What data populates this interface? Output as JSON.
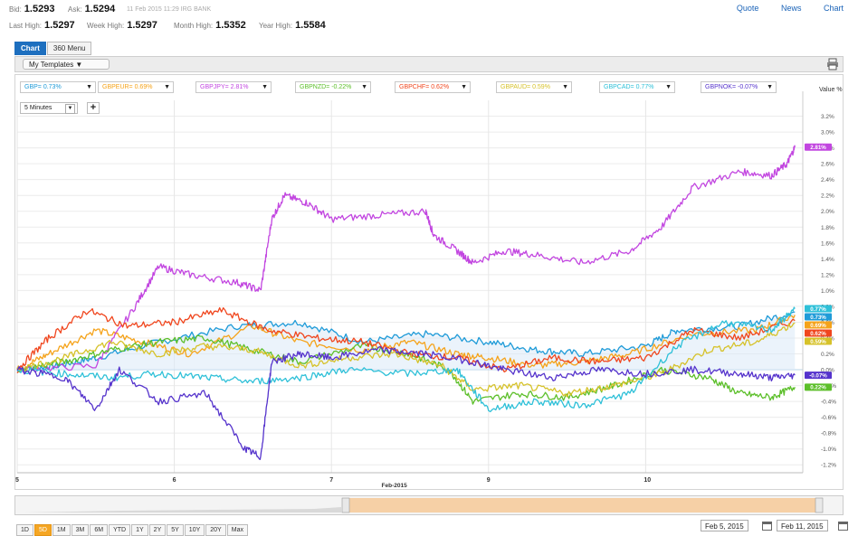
{
  "quote": {
    "items": [
      {
        "label": "Bid:",
        "value": "1.5293"
      },
      {
        "label": "Ask:",
        "value": "1.5294"
      },
      {
        "label": "Last High:",
        "value": "1.5297"
      },
      {
        "label": "Week High:",
        "value": "1.5297"
      },
      {
        "label": "Month High:",
        "value": "1.5352"
      },
      {
        "label": "Year High:",
        "value": "1.5584"
      }
    ],
    "timestamp": "11 Feb 2015 11:29 IRG BANK"
  },
  "links": {
    "quote": "Quote",
    "news": "News",
    "chart": "Chart"
  },
  "tabs": [
    {
      "label": "Chart"
    },
    {
      "label": "360 Menu"
    }
  ],
  "toolbar": {
    "templates_label": "My Templates ▼"
  },
  "controls": {
    "interval": "5 Minutes",
    "dropdown": "▼",
    "plus": "+"
  },
  "bottom": {
    "ranges": [
      "1D",
      "5D",
      "1M",
      "3M",
      "6M",
      "YTD",
      "1Y",
      "2Y",
      "5Y",
      "10Y",
      "20Y",
      "Max"
    ],
    "active_range": "5D",
    "date_from": "Feb 5, 2015",
    "date_to": "Feb 11, 2015"
  },
  "chart_data": {
    "type": "line",
    "ylabel": "Value %",
    "xlabel": "Feb-2015",
    "ylim": [
      -1.3,
      3.4
    ],
    "xlim": [
      0,
      5
    ],
    "x_ticks": [
      {
        "x": 0,
        "label": "5"
      },
      {
        "x": 1,
        "label": "6"
      },
      {
        "x": 2,
        "label": "7"
      },
      {
        "x": 3,
        "label": "9"
      },
      {
        "x": 4,
        "label": "10"
      }
    ],
    "y_ticks": [
      3.2,
      3.0,
      2.8,
      2.6,
      2.4,
      2.2,
      2.0,
      1.8,
      1.6,
      1.4,
      1.2,
      1.0,
      0.8,
      0.6,
      0.4,
      0.2,
      0.0,
      -0.2,
      -0.4,
      -0.6,
      -0.8,
      -1.0,
      -1.2
    ],
    "y_tick_labels": [
      "3.2%",
      "3.0%",
      "2.8%",
      "2.6%",
      "2.4%",
      "2.2%",
      "2.0%",
      "1.8%",
      "1.6%",
      "1.4%",
      "1.2%",
      "1.0%",
      "0.8%",
      "0.6%",
      "0.4%",
      "0.2%",
      "0.0%",
      "-0.2%",
      "-0.4%",
      "-0.6%",
      "-0.8%",
      "-1.0%",
      "-1.2%"
    ],
    "grid": true,
    "series": [
      {
        "name": "GBP=",
        "legend": "GBP= 0.73%",
        "end_label": "0.73%",
        "color": "#1f9bd8",
        "x": [
          0,
          0.25,
          0.5,
          0.9,
          1.4,
          1.8,
          2.2,
          2.6,
          3.0,
          3.3,
          3.6,
          4.0,
          4.2,
          4.6,
          4.95
        ],
        "y": [
          0.0,
          0.05,
          0.15,
          0.35,
          0.55,
          0.6,
          0.35,
          0.45,
          0.35,
          0.25,
          0.2,
          0.3,
          0.5,
          0.55,
          0.73
        ]
      },
      {
        "name": "GBPEUR=",
        "legend": "GBPEUR= 0.69%",
        "end_label": "0.69%",
        "color": "#f5a31a",
        "x": [
          0,
          0.2,
          0.5,
          0.8,
          1.1,
          1.5,
          1.8,
          2.2,
          2.5,
          2.8,
          3.0,
          3.3,
          3.6,
          3.9,
          4.3,
          4.7,
          4.95
        ],
        "y": [
          0.0,
          0.2,
          0.5,
          0.35,
          0.2,
          0.55,
          0.35,
          0.25,
          0.35,
          0.2,
          0.15,
          0.05,
          0.1,
          0.2,
          0.45,
          0.5,
          0.69
        ]
      },
      {
        "name": "GBPJPY=",
        "legend": "GBPJPY= 2.81%",
        "end_label": "2.81%",
        "color": "#c246e0",
        "x": [
          0,
          0.5,
          0.75,
          0.9,
          1.1,
          1.4,
          1.55,
          1.62,
          1.7,
          1.85,
          2.0,
          2.3,
          2.6,
          2.65,
          2.8,
          2.9,
          3.1,
          3.3,
          3.6,
          3.9,
          4.1,
          4.3,
          4.6,
          4.8,
          4.9,
          4.95
        ],
        "y": [
          0.0,
          0.05,
          0.8,
          1.3,
          1.2,
          1.1,
          1.0,
          1.9,
          2.2,
          2.1,
          1.9,
          1.95,
          2.0,
          1.7,
          1.5,
          1.35,
          1.5,
          1.45,
          1.35,
          1.5,
          1.8,
          2.3,
          2.5,
          2.45,
          2.6,
          2.81
        ]
      },
      {
        "name": "GBPNZD=",
        "legend": "GBPNZD= -0.22%",
        "end_label": "0.22%",
        "color": "#5cbf2a",
        "x": [
          0,
          0.3,
          0.6,
          0.9,
          1.2,
          1.5,
          1.8,
          2.2,
          2.5,
          2.75,
          2.9,
          3.2,
          3.5,
          3.8,
          4.1,
          4.4,
          4.6,
          4.8,
          4.95
        ],
        "y": [
          0.0,
          0.1,
          0.25,
          0.35,
          0.4,
          0.25,
          0.1,
          0.3,
          0.2,
          0.0,
          -0.4,
          -0.3,
          -0.35,
          -0.2,
          0.0,
          -0.1,
          -0.3,
          -0.35,
          -0.22
        ]
      },
      {
        "name": "GBPCHF=",
        "legend": "GBPCHF= 0.62%",
        "end_label": "0.62%",
        "color": "#f0461e",
        "x": [
          0,
          0.2,
          0.45,
          0.7,
          1.0,
          1.3,
          1.6,
          1.9,
          2.2,
          2.5,
          2.8,
          3.1,
          3.4,
          3.7,
          4.0,
          4.3,
          4.6,
          4.95
        ],
        "y": [
          0.0,
          0.4,
          0.75,
          0.55,
          0.6,
          0.75,
          0.5,
          0.4,
          0.35,
          0.2,
          0.15,
          0.0,
          0.15,
          0.1,
          0.15,
          0.5,
          0.4,
          0.62
        ]
      },
      {
        "name": "GBPAUD=",
        "legend": "GBPAUD= 0.59%",
        "end_label": "0.59%",
        "color": "#d6c22a",
        "x": [
          0,
          0.3,
          0.6,
          0.9,
          1.2,
          1.5,
          1.8,
          2.1,
          2.4,
          2.7,
          2.9,
          3.2,
          3.5,
          3.8,
          4.1,
          4.4,
          4.7,
          4.95
        ],
        "y": [
          0.0,
          0.15,
          0.35,
          0.2,
          0.3,
          0.25,
          0.05,
          0.15,
          0.2,
          0.05,
          -0.25,
          -0.2,
          -0.3,
          -0.2,
          -0.05,
          0.25,
          0.35,
          0.59
        ]
      },
      {
        "name": "GBPCAD=",
        "legend": "GBPCAD= 0.77%",
        "end_label": "0.77%",
        "color": "#2ec0d8",
        "x": [
          0,
          0.3,
          0.6,
          0.9,
          1.2,
          1.5,
          1.8,
          2.1,
          2.5,
          2.8,
          3.0,
          3.3,
          3.6,
          3.9,
          4.2,
          4.5,
          4.8,
          4.95
        ],
        "y": [
          0.0,
          -0.05,
          -0.1,
          -0.05,
          -0.1,
          -0.15,
          -0.1,
          0.0,
          -0.05,
          0.0,
          -0.5,
          -0.4,
          -0.45,
          -0.3,
          0.3,
          0.6,
          0.5,
          0.77
        ]
      },
      {
        "name": "GBPNOK=",
        "legend": "GBPNOK= -0.07%",
        "end_label": "-0.07%",
        "color": "#5533cc",
        "x": [
          0,
          0.3,
          0.5,
          0.65,
          0.9,
          1.2,
          1.45,
          1.55,
          1.62,
          1.8,
          2.0,
          2.3,
          2.6,
          2.9,
          3.1,
          3.4,
          3.7,
          4.0,
          4.3,
          4.6,
          4.8,
          4.95
        ],
        "y": [
          0.0,
          -0.1,
          -0.5,
          0.0,
          -0.4,
          -0.3,
          -1.0,
          -1.1,
          0.1,
          0.2,
          0.15,
          0.25,
          0.2,
          0.1,
          0.0,
          -0.1,
          0.0,
          -0.05,
          0.0,
          -0.05,
          -0.1,
          -0.07
        ]
      }
    ]
  }
}
